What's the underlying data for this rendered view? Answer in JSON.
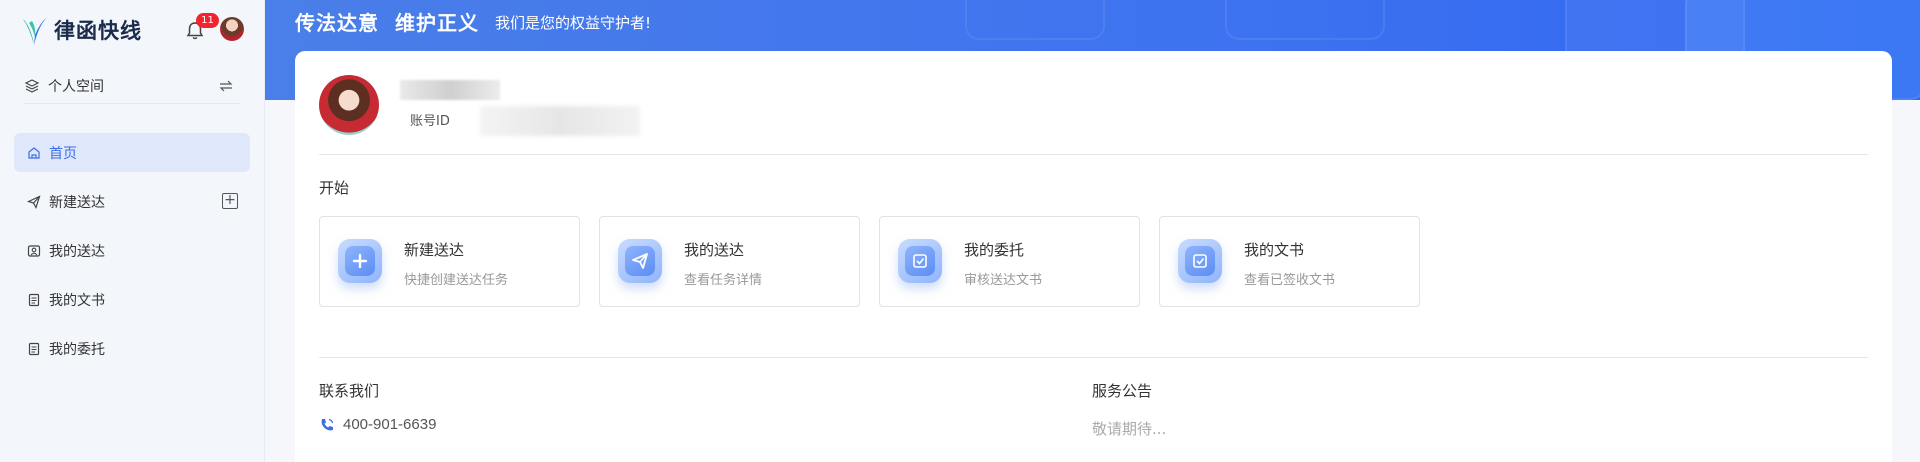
{
  "app": {
    "name": "律函快线",
    "notification_count": "11"
  },
  "sidebar": {
    "space_label": "个人空间",
    "items": [
      {
        "label": "首页",
        "icon": "home-icon",
        "active": true
      },
      {
        "label": "新建送达",
        "icon": "send-icon",
        "active": false
      },
      {
        "label": "我的送达",
        "icon": "contacts-icon",
        "active": false
      },
      {
        "label": "我的文书",
        "icon": "document-icon",
        "active": false
      },
      {
        "label": "我的委托",
        "icon": "document-icon",
        "active": false
      }
    ]
  },
  "banner": {
    "slogan_1": "传法达意",
    "slogan_2": "维护正义",
    "slogan_3": "我们是您的权益守护者!"
  },
  "profile": {
    "account_label": "账号ID"
  },
  "start": {
    "title": "开始",
    "tiles": [
      {
        "title": "新建送达",
        "subtitle": "快捷创建送达任务",
        "icon": "plus-icon"
      },
      {
        "title": "我的送达",
        "subtitle": "查看任务详情",
        "icon": "paper-plane-icon"
      },
      {
        "title": "我的委托",
        "subtitle": "审核送达文书",
        "icon": "document-check-icon"
      },
      {
        "title": "我的文书",
        "subtitle": "查看已签收文书",
        "icon": "document-check-icon"
      }
    ]
  },
  "contact": {
    "title": "联系我们",
    "phone": "400-901-6639"
  },
  "notice": {
    "title": "服务公告",
    "text": "敬请期待..."
  },
  "colors": {
    "accent": "#3a6de6",
    "banner": "#3d72f0",
    "badge": "#f5222d"
  }
}
